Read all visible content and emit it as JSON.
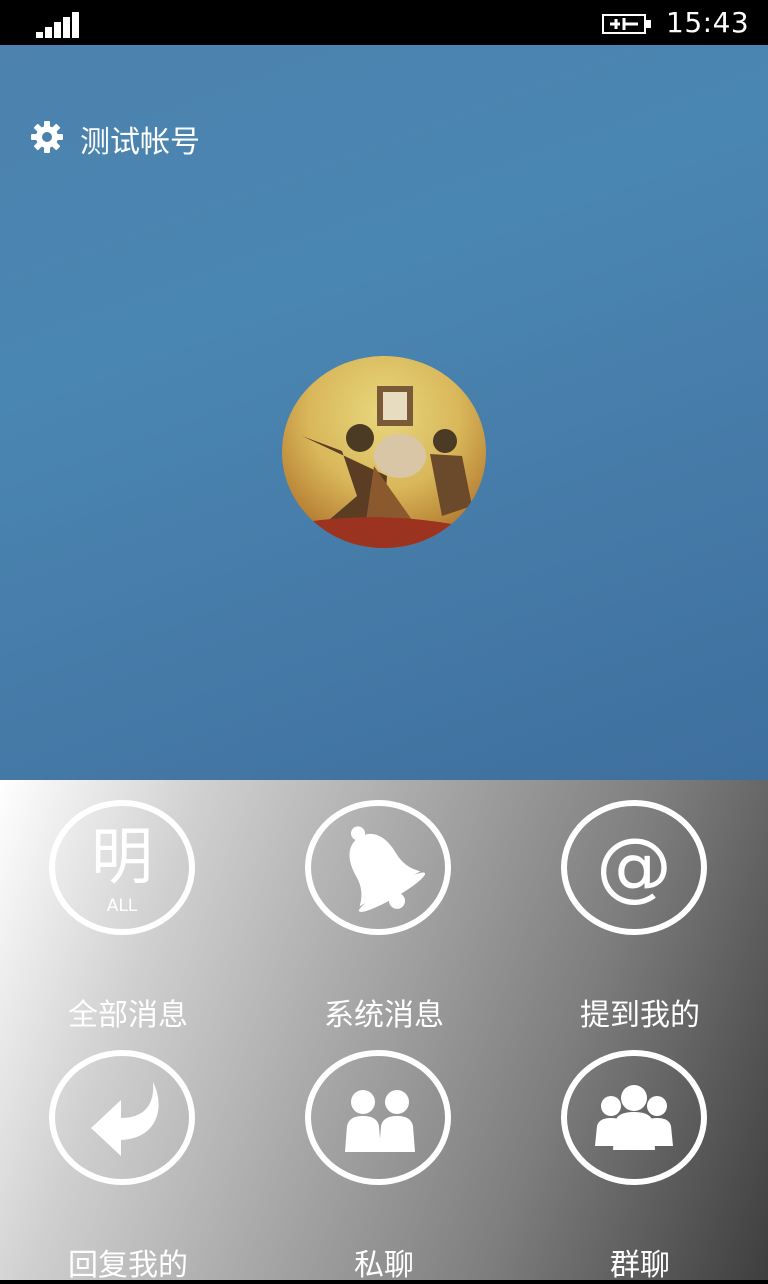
{
  "status_bar": {
    "time": "15:43",
    "signal_icon": "signal-bars-icon",
    "battery_icon": "battery-charging-icon"
  },
  "header": {
    "settings_icon": "gear-icon",
    "account_name": "测试帐号",
    "avatar": "profile-avatar-image",
    "background_color": "#4a80ac"
  },
  "menu": {
    "items": [
      {
        "label": "全部消息",
        "icon": "all-messages-icon",
        "glyph": "明",
        "sub": "ALL"
      },
      {
        "label": "系统消息",
        "icon": "bell-icon"
      },
      {
        "label": "提到我的",
        "icon": "at-icon",
        "glyph": "@"
      },
      {
        "label": "回复我的",
        "icon": "reply-arrow-icon"
      },
      {
        "label": "私聊",
        "icon": "two-people-icon"
      },
      {
        "label": "群聊",
        "icon": "group-people-icon"
      }
    ]
  }
}
